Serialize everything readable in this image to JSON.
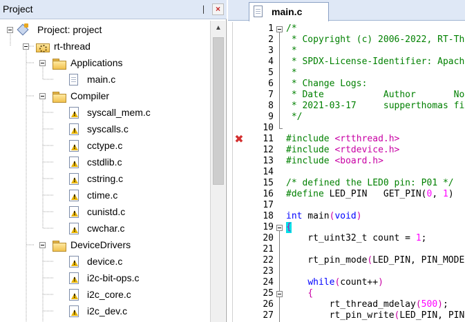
{
  "project_panel": {
    "title": "Project",
    "pin_glyph": "❘",
    "close_glyph": "×",
    "scroll_up_glyph": "▲",
    "tree": {
      "root": "Project: project",
      "group": "rt-thread",
      "folders": [
        {
          "name": "Applications",
          "files": [
            "main.c"
          ]
        },
        {
          "name": "Compiler",
          "files": [
            "syscall_mem.c",
            "syscalls.c",
            "cctype.c",
            "cstdlib.c",
            "cstring.c",
            "ctime.c",
            "cunistd.c",
            "cwchar.c"
          ]
        },
        {
          "name": "DeviceDrivers",
          "files": [
            "device.c",
            "i2c-bit-ops.c",
            "i2c_core.c",
            "i2c_dev.c"
          ]
        }
      ]
    }
  },
  "editor": {
    "tab_label": "main.c",
    "error_glyph": "✖",
    "lines": [
      {
        "n": "1",
        "t": "/*"
      },
      {
        "n": "2",
        "t": " * Copyright (c) 2006-2022, RT-Th"
      },
      {
        "n": "3",
        "t": " *"
      },
      {
        "n": "4",
        "t": " * SPDX-License-Identifier: Apach"
      },
      {
        "n": "5",
        "t": " *"
      },
      {
        "n": "6",
        "t": " * Change Logs:"
      },
      {
        "n": "7",
        "t": " * Date           Author       No"
      },
      {
        "n": "8",
        "t": " * 2021-03-17     supperthomas fi"
      },
      {
        "n": "9",
        "t": " */"
      },
      {
        "n": "10",
        "t": ""
      },
      {
        "n": "11",
        "t": "#include <rtthread.h>"
      },
      {
        "n": "12",
        "t": "#include <rtdevice.h>"
      },
      {
        "n": "13",
        "t": "#include <board.h>"
      },
      {
        "n": "14",
        "t": ""
      },
      {
        "n": "15",
        "t": "/* defined the LED0 pin: P01 */"
      },
      {
        "n": "16",
        "t": "#define LED_PIN   GET_PIN(0, 1)"
      },
      {
        "n": "17",
        "t": ""
      },
      {
        "n": "18",
        "t": "int main(void)"
      },
      {
        "n": "19",
        "t": "{"
      },
      {
        "n": "20",
        "t": "    rt_uint32_t count = 1;"
      },
      {
        "n": "21",
        "t": ""
      },
      {
        "n": "22",
        "t": "    rt_pin_mode(LED_PIN, PIN_MODE"
      },
      {
        "n": "23",
        "t": ""
      },
      {
        "n": "24",
        "t": "    while(count++)"
      },
      {
        "n": "25",
        "t": "    {"
      },
      {
        "n": "26",
        "t": "        rt_thread_mdelay(500);"
      },
      {
        "n": "27",
        "t": "        rt_pin_write(LED_PIN, PIN"
      }
    ]
  },
  "colors": {
    "comment": "#008000",
    "keyword": "#0000ff",
    "error": "#d32f2f",
    "brace_highlight": "#00e0e8",
    "panel_header": "#dfe8f6"
  }
}
